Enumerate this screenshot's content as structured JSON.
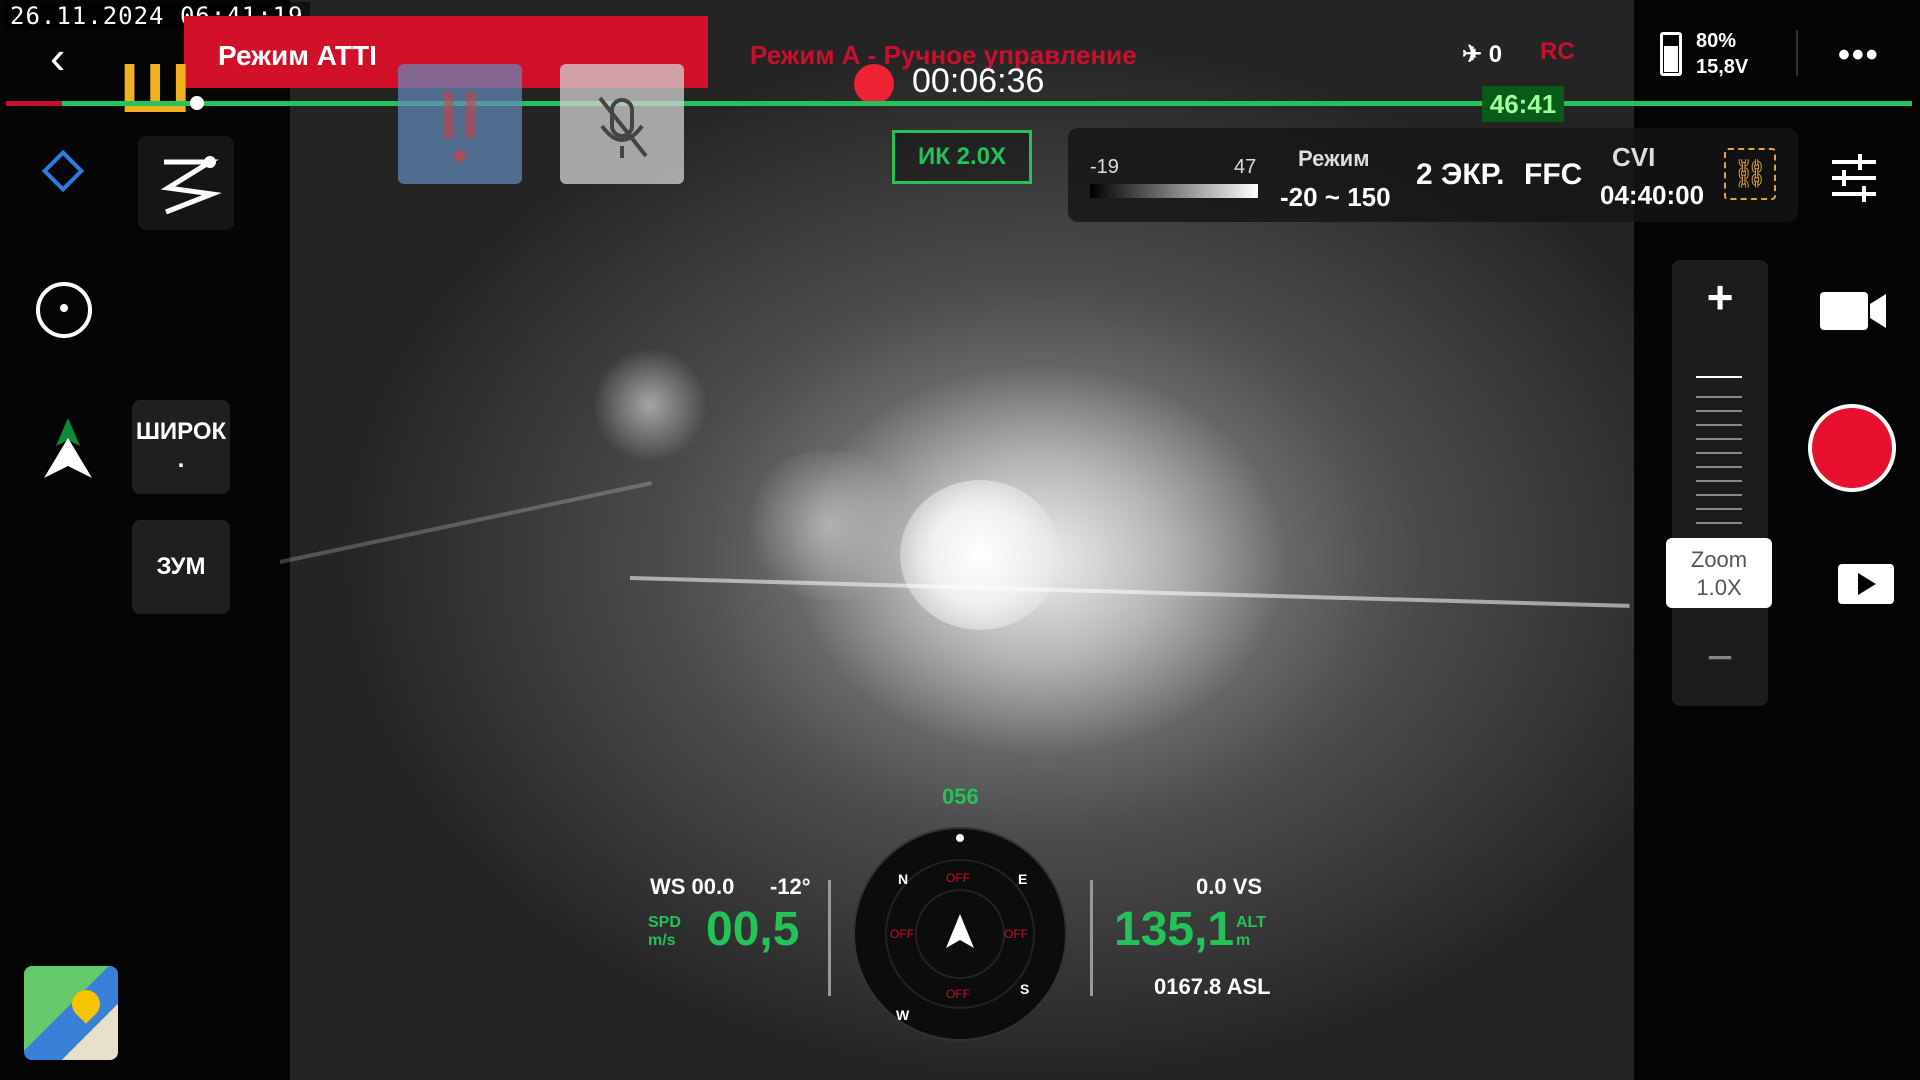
{
  "osd": {
    "timestamp": "26.11.2024 06:41:19"
  },
  "top_bar": {
    "back_icon": "chevron-left-icon",
    "flight_mode": "Режим ATTI",
    "control_mode": "Режим А - Ручное управление",
    "recording_time": "00:06:36",
    "remaining_flight_time": "46:41",
    "satellites": "0",
    "rc_label": "RC",
    "battery_percent": "80%",
    "battery_voltage": "15,8V",
    "more_icon": "more-horizontal-icon",
    "accent_green": "#23c35a",
    "accent_red": "#d2102a"
  },
  "camera": {
    "ir_zoom": "ИК 2.0X"
  },
  "thermal": {
    "min": "-19",
    "max": "47",
    "mode_label": "Режим",
    "range": "-20 ~ 150",
    "screens": "2 ЭКР.",
    "ffc": "FFC",
    "cvi": "CVI",
    "time": "04:40:00",
    "link_icon": "link-icon"
  },
  "left_panel": {
    "wide_label": "ШИРОК",
    "wide_sub": ".",
    "zoom_label": "ЗУМ"
  },
  "right_panel": {
    "zoom_label": "Zoom",
    "zoom_value": "1.0X",
    "plus": "+",
    "minus": "−"
  },
  "hud": {
    "heading": "056",
    "ws": "WS 00.0",
    "pitch": "-12°",
    "spd_unit_1": "SPD",
    "spd_unit_2": "m/s",
    "spd": "00,5",
    "vs": "0.0 VS",
    "alt": "135,1",
    "alt_unit_1": "ALT",
    "alt_unit_2": "m",
    "asl": "0167.8 ASL",
    "compass_n": "N",
    "compass_e": "E",
    "compass_s": "S",
    "compass_w": "W",
    "off": "OFF"
  }
}
